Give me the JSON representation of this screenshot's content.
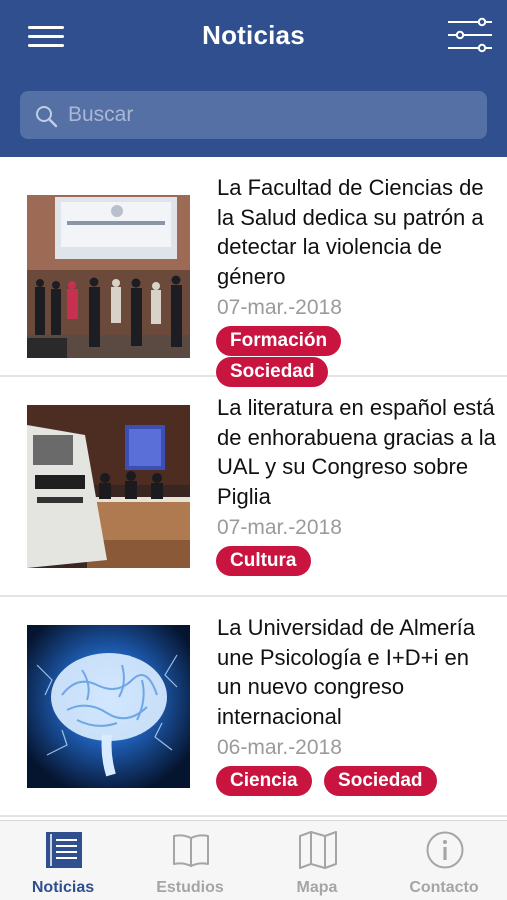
{
  "header": {
    "title": "Noticias",
    "menu_icon": "hamburger-menu-icon",
    "filter_icon": "filter-sliders-icon"
  },
  "search": {
    "placeholder": "Buscar",
    "value": "",
    "icon": "search-icon"
  },
  "news": [
    {
      "title": "La Facultad de Ciencias de la Salud dedica su patrón a detectar la violencia de género",
      "date": "07-mar.-2018",
      "tags": [
        "Formación",
        "Sociedad"
      ],
      "image": "group-photo-thumbnail"
    },
    {
      "title": "La literatura en español está de enhorabuena gracias a la UAL y su Congreso sobre Piglia",
      "date": "07-mar.-2018",
      "tags": [
        "Cultura"
      ],
      "image": "conference-photo-thumbnail"
    },
    {
      "title": "La Universidad de Almería une Psicología e I+D+i en un nuevo congreso internacional",
      "date": "06-mar.-2018",
      "tags": [
        "Ciencia",
        "Sociedad"
      ],
      "image": "brain-illustration-thumbnail"
    }
  ],
  "tabs": [
    {
      "label": "Noticias",
      "icon": "newspaper-icon",
      "active": true
    },
    {
      "label": "Estudios",
      "icon": "book-icon",
      "active": false
    },
    {
      "label": "Mapa",
      "icon": "map-icon",
      "active": false
    },
    {
      "label": "Contacto",
      "icon": "info-icon",
      "active": false
    }
  ],
  "colors": {
    "header": "#2f4f8f",
    "search_bg": "#5470a5",
    "tag": "#c8143f",
    "tab_active": "#2f4f8f",
    "tab_inactive": "#a5a5a5"
  }
}
